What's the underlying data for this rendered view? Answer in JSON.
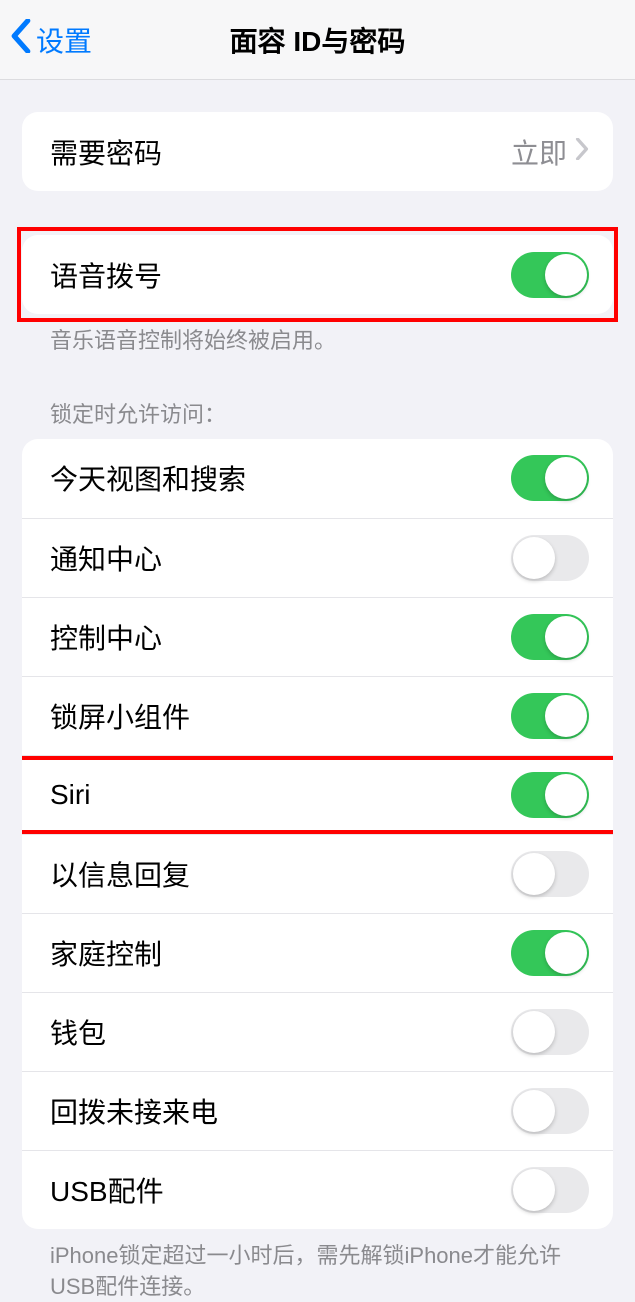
{
  "nav": {
    "back_label": "设置",
    "title": "面容 ID与密码"
  },
  "passcode_row": {
    "label": "需要密码",
    "value": "立即"
  },
  "voice_dial": {
    "label": "语音拨号",
    "footer": "音乐语音控制将始终被启用。"
  },
  "lock_access": {
    "header": "锁定时允许访问：",
    "items": [
      {
        "label": "今天视图和搜索",
        "on": true
      },
      {
        "label": "通知中心",
        "on": false
      },
      {
        "label": "控制中心",
        "on": true
      },
      {
        "label": "锁屏小组件",
        "on": true
      },
      {
        "label": "Siri",
        "on": true
      },
      {
        "label": "以信息回复",
        "on": false
      },
      {
        "label": "家庭控制",
        "on": true
      },
      {
        "label": "钱包",
        "on": false
      },
      {
        "label": "回拨未接来电",
        "on": false
      },
      {
        "label": "USB配件",
        "on": false
      }
    ],
    "footer": "iPhone锁定超过一小时后，需先解锁iPhone才能允许USB配件连接。"
  }
}
